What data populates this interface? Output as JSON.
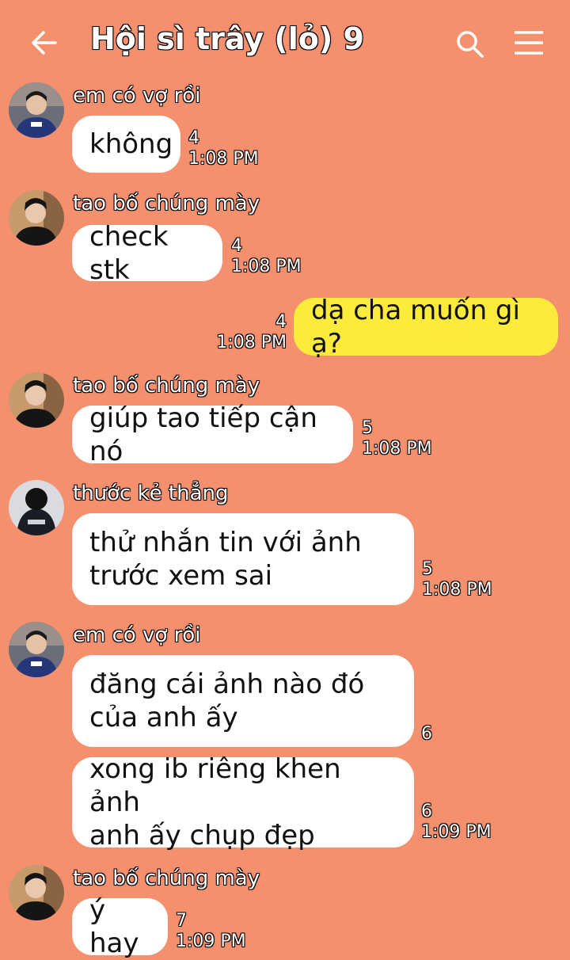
{
  "header": {
    "title": "Hội sì trây (lỏ) 9"
  },
  "messages": [
    {
      "sender": "em có vợ rồi",
      "text": "không",
      "count": "4",
      "time": "1:08 PM"
    },
    {
      "sender": "tao bố chúng mày",
      "text": "check stk",
      "count": "4",
      "time": "1:08 PM"
    },
    {
      "sender": "",
      "text": "dạ cha muốn gì ạ?",
      "count": "4",
      "time": "1:08 PM",
      "mine": true
    },
    {
      "sender": "tao bố chúng mày",
      "text": "giúp tao tiếp cận nó",
      "count": "5",
      "time": "1:08 PM"
    },
    {
      "sender": "thước kẻ thẳng",
      "text": "thử nhắn tin với ảnh\ntrước xem sai",
      "count": "5",
      "time": "1:08 PM"
    },
    {
      "sender": "em có vợ rồi",
      "text": "đăng cái ảnh nào đó\ncủa anh ấy",
      "count": "6",
      "time": ""
    },
    {
      "sender": "",
      "text": "xong ib riêng khen ảnh\nanh ấy chụp đẹp",
      "count": "6",
      "time": "1:09 PM"
    },
    {
      "sender": "tao bố chúng mày",
      "text": "ý hay",
      "count": "7",
      "time": "1:09 PM"
    }
  ],
  "colors": {
    "background": "#f5906f",
    "bubble_incoming": "#ffffff",
    "bubble_outgoing": "#fdeb3c"
  },
  "icons": [
    "back-arrow-icon",
    "search-icon",
    "menu-icon"
  ]
}
